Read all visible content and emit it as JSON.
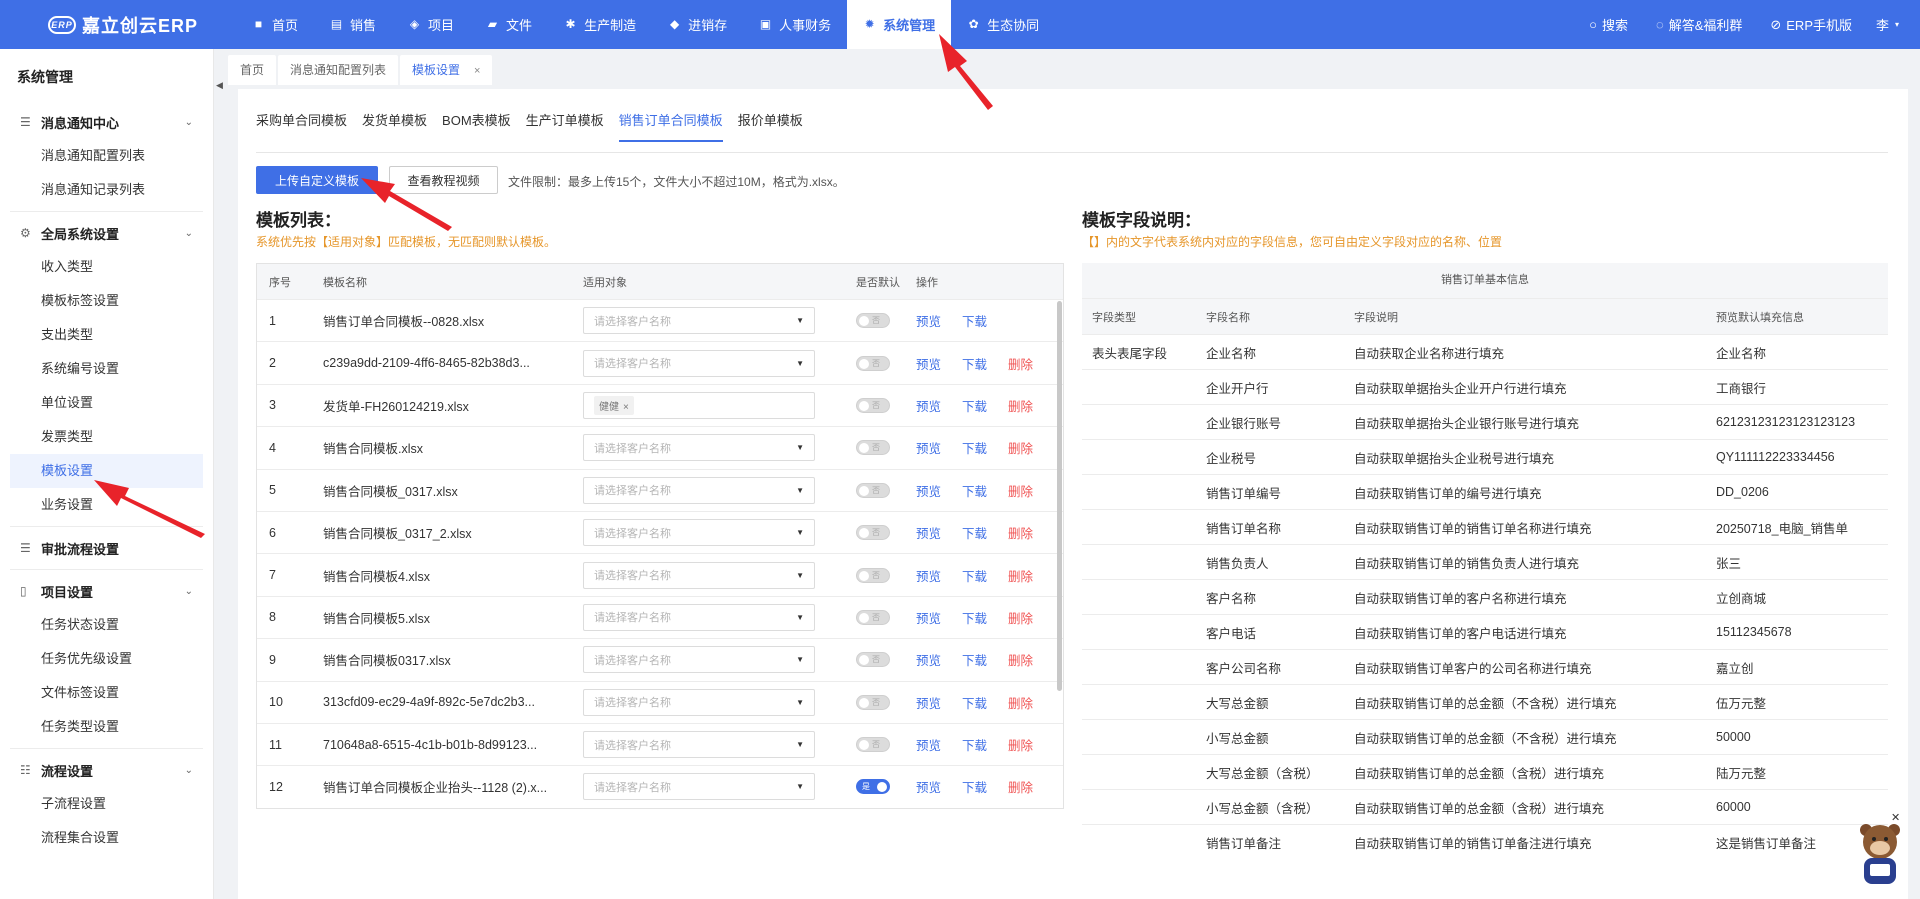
{
  "app": {
    "logo_mark": "ERP",
    "logo_text": "嘉立创云ERP"
  },
  "nav": {
    "items": [
      {
        "label": "首页",
        "icon": "home-icon",
        "glyph": "■"
      },
      {
        "label": "销售",
        "icon": "sales-icon",
        "glyph": "▤"
      },
      {
        "label": "项目",
        "icon": "project-icon",
        "glyph": "◈"
      },
      {
        "label": "文件",
        "icon": "folder-icon",
        "glyph": "▰"
      },
      {
        "label": "生产制造",
        "icon": "gear-icon",
        "glyph": "✱"
      },
      {
        "label": "进销存",
        "icon": "box-icon",
        "glyph": "◆"
      },
      {
        "label": "人事财务",
        "icon": "finance-icon",
        "glyph": "▣"
      },
      {
        "label": "系统管理",
        "icon": "settings-icon",
        "glyph": "✹"
      },
      {
        "label": "生态协同",
        "icon": "ecosystem-icon",
        "glyph": "✿"
      }
    ],
    "search_label": "搜索",
    "help_label": "解答&福利群",
    "mobile_label": "ERP手机版",
    "user_label": "李"
  },
  "sidebar": {
    "title": "系统管理",
    "groups": {
      "message": {
        "label": "消息通知中心",
        "items": [
          "消息通知配置列表",
          "消息通知记录列表"
        ]
      },
      "global": {
        "label": "全局系统设置",
        "items": [
          "收入类型",
          "模板标签设置",
          "支出类型",
          "系统编号设置",
          "单位设置",
          "发票类型",
          "模板设置",
          "业务设置"
        ]
      },
      "approval": {
        "label": "审批流程设置"
      },
      "project": {
        "label": "项目设置",
        "items": [
          "任务状态设置",
          "任务优先级设置",
          "文件标签设置",
          "任务类型设置"
        ]
      },
      "flow": {
        "label": "流程设置",
        "items": [
          "子流程设置",
          "流程集合设置"
        ]
      }
    }
  },
  "page_tabs": {
    "home": "首页",
    "msg_config": "消息通知配置列表",
    "template": "模板设置",
    "close": "×"
  },
  "subtabs": [
    "采购单合同模板",
    "发货单模板",
    "BOM表模板",
    "生产订单模板",
    "销售订单合同模板",
    "报价单模板"
  ],
  "toolbar": {
    "upload_label": "上传自定义模板",
    "video_label": "查看教程视频",
    "file_limit": "文件限制：最多上传15个，文件大小不超过10M，格式为.xlsx。"
  },
  "template_list": {
    "title": "模板列表：",
    "note": "系统优先按【适用对象】匹配模板，无匹配则默认模板。",
    "headers": {
      "no": "序号",
      "name": "模板名称",
      "target": "适用对象",
      "default": "是否默认",
      "ops": "操作"
    },
    "select_placeholder": "请选择客户名称",
    "preview": "预览",
    "download": "下载",
    "delete": "删除",
    "switch_off": "否",
    "switch_on": "是",
    "rows": [
      {
        "no": "1",
        "name": "销售订单合同模板--0828.xlsx",
        "tag": "",
        "default": false,
        "deletable": false
      },
      {
        "no": "2",
        "name": "c239a9dd-2109-4ff6-8465-82b38d3...",
        "tag": "",
        "default": false,
        "deletable": true
      },
      {
        "no": "3",
        "name": "发货单-FH260124219.xlsx",
        "tag": "健健",
        "default": false,
        "deletable": true
      },
      {
        "no": "4",
        "name": "销售合同模板.xlsx",
        "tag": "",
        "default": false,
        "deletable": true
      },
      {
        "no": "5",
        "name": "销售合同模板_0317.xlsx",
        "tag": "",
        "default": false,
        "deletable": true
      },
      {
        "no": "6",
        "name": "销售合同模板_0317_2.xlsx",
        "tag": "",
        "default": false,
        "deletable": true
      },
      {
        "no": "7",
        "name": "销售合同模板4.xlsx",
        "tag": "",
        "default": false,
        "deletable": true
      },
      {
        "no": "8",
        "name": "销售合同模板5.xlsx",
        "tag": "",
        "default": false,
        "deletable": true
      },
      {
        "no": "9",
        "name": "销售合同模板0317.xlsx",
        "tag": "",
        "default": false,
        "deletable": true
      },
      {
        "no": "10",
        "name": "313cfd09-ec29-4a9f-892c-5e7dc2b3...",
        "tag": "",
        "default": false,
        "deletable": true
      },
      {
        "no": "11",
        "name": "710648a8-6515-4c1b-b01b-8d99123...",
        "tag": "",
        "default": false,
        "deletable": true
      },
      {
        "no": "12",
        "name": "销售订单合同模板企业抬头--1128 (2).x...",
        "tag": "",
        "default": true,
        "deletable": true
      }
    ]
  },
  "field_desc": {
    "title": "模板字段说明：",
    "note": "【】内的文字代表系统内对应的字段信息，您可自由定义字段对应的名称、位置",
    "caption": "销售订单基本信息",
    "headers": {
      "type": "字段类型",
      "name": "字段名称",
      "desc": "字段说明",
      "default": "预览默认填充信息"
    },
    "rows": [
      {
        "type": "表头表尾字段",
        "name": "企业名称",
        "desc": "自动获取企业名称进行填充",
        "default": "企业名称"
      },
      {
        "type": "",
        "name": "企业开户行",
        "desc": "自动获取单据抬头企业开户行进行填充",
        "default": "工商银行"
      },
      {
        "type": "",
        "name": "企业银行账号",
        "desc": "自动获取单据抬头企业银行账号进行填充",
        "default": "62123123123123123123"
      },
      {
        "type": "",
        "name": "企业税号",
        "desc": "自动获取单据抬头企业税号进行填充",
        "default": "QY111112223334456"
      },
      {
        "type": "",
        "name": "销售订单编号",
        "desc": "自动获取销售订单的编号进行填充",
        "default": "DD_0206"
      },
      {
        "type": "",
        "name": "销售订单名称",
        "desc": "自动获取销售订单的销售订单名称进行填充",
        "default": "20250718_电脑_销售单"
      },
      {
        "type": "",
        "name": "销售负责人",
        "desc": "自动获取销售订单的销售负责人进行填充",
        "default": "张三"
      },
      {
        "type": "",
        "name": "客户名称",
        "desc": "自动获取销售订单的客户名称进行填充",
        "default": "立创商城"
      },
      {
        "type": "",
        "name": "客户电话",
        "desc": "自动获取销售订单的客户电话进行填充",
        "default": "15112345678"
      },
      {
        "type": "",
        "name": "客户公司名称",
        "desc": "自动获取销售订单客户的公司名称进行填充",
        "default": "嘉立创"
      },
      {
        "type": "",
        "name": "大写总金额",
        "desc": "自动获取销售订单的总金额（不含税）进行填充",
        "default": "伍万元整"
      },
      {
        "type": "",
        "name": "小写总金额",
        "desc": "自动获取销售订单的总金额（不含税）进行填充",
        "default": "50000"
      },
      {
        "type": "",
        "name": "大写总金额（含税）",
        "desc": "自动获取销售订单的总金额（含税）进行填充",
        "default": "陆万元整"
      },
      {
        "type": "",
        "name": "小写总金额（含税）",
        "desc": "自动获取销售订单的总金额（含税）进行填充",
        "default": "60000"
      },
      {
        "type": "",
        "name": "销售订单备注",
        "desc": "自动获取销售订单的销售订单备注进行填充",
        "default": "这是销售订单备注"
      }
    ]
  },
  "colors": {
    "primary": "#3f6fe6",
    "danger": "#f05454",
    "note": "#e6962a",
    "arrow": "#e8232a"
  }
}
